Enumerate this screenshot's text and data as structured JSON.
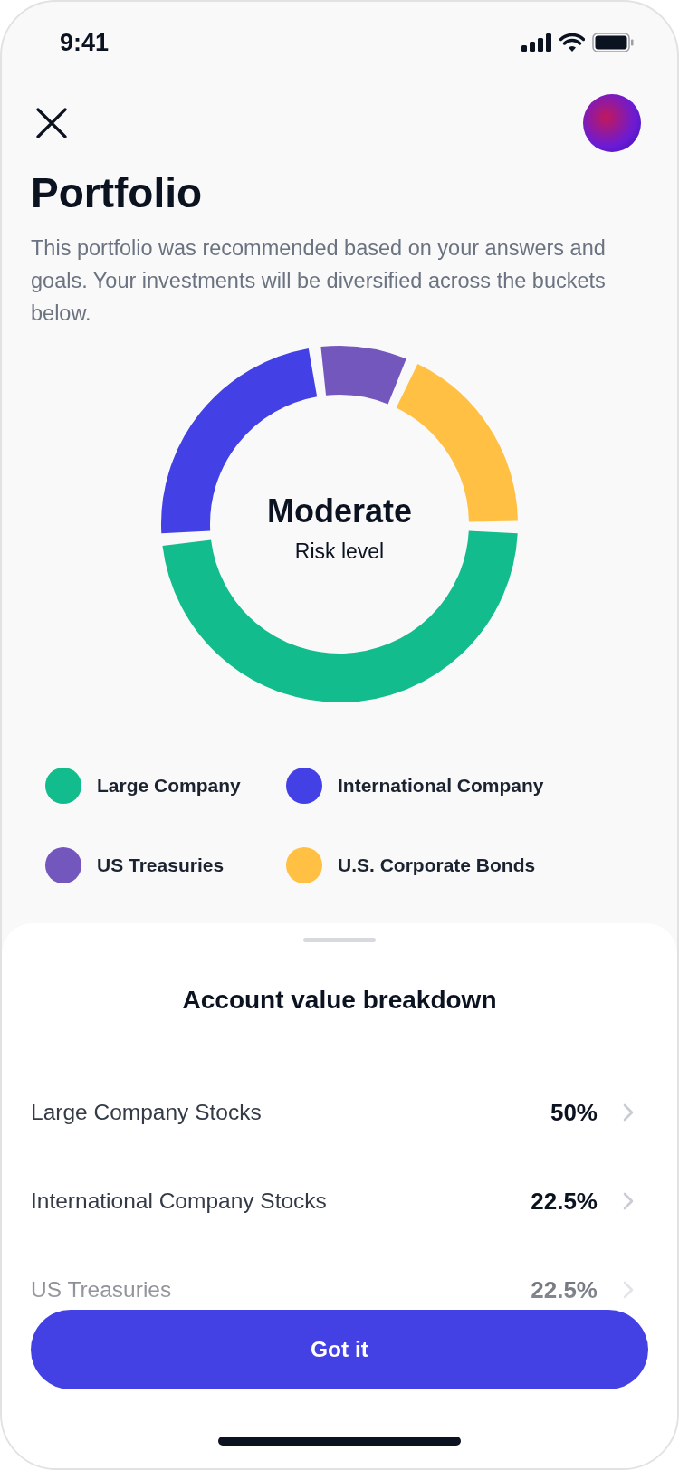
{
  "status_bar": {
    "time": "9:41"
  },
  "title": "Portfolio",
  "description": "This portfolio was recommended based on your answers and goals. Your investments will be diversified across the buckets below.",
  "risk": {
    "value": "Moderate",
    "label": "Risk level"
  },
  "legend": [
    {
      "label": "Large Company",
      "color": "#13bc8c"
    },
    {
      "label": "International Company",
      "color": "#4341e6"
    },
    {
      "label": "US Treasuries",
      "color": "#7357bd"
    },
    {
      "label": "U.S. Corporate Bonds",
      "color": "#ffc044"
    }
  ],
  "sheet": {
    "title": "Account value breakdown",
    "rows": [
      {
        "name": "Large Company Stocks",
        "value": "50%"
      },
      {
        "name": "International Company Stocks",
        "value": "22.5%"
      },
      {
        "name": "US Treasuries",
        "value": "22.5%"
      }
    ]
  },
  "button": "Got it"
}
